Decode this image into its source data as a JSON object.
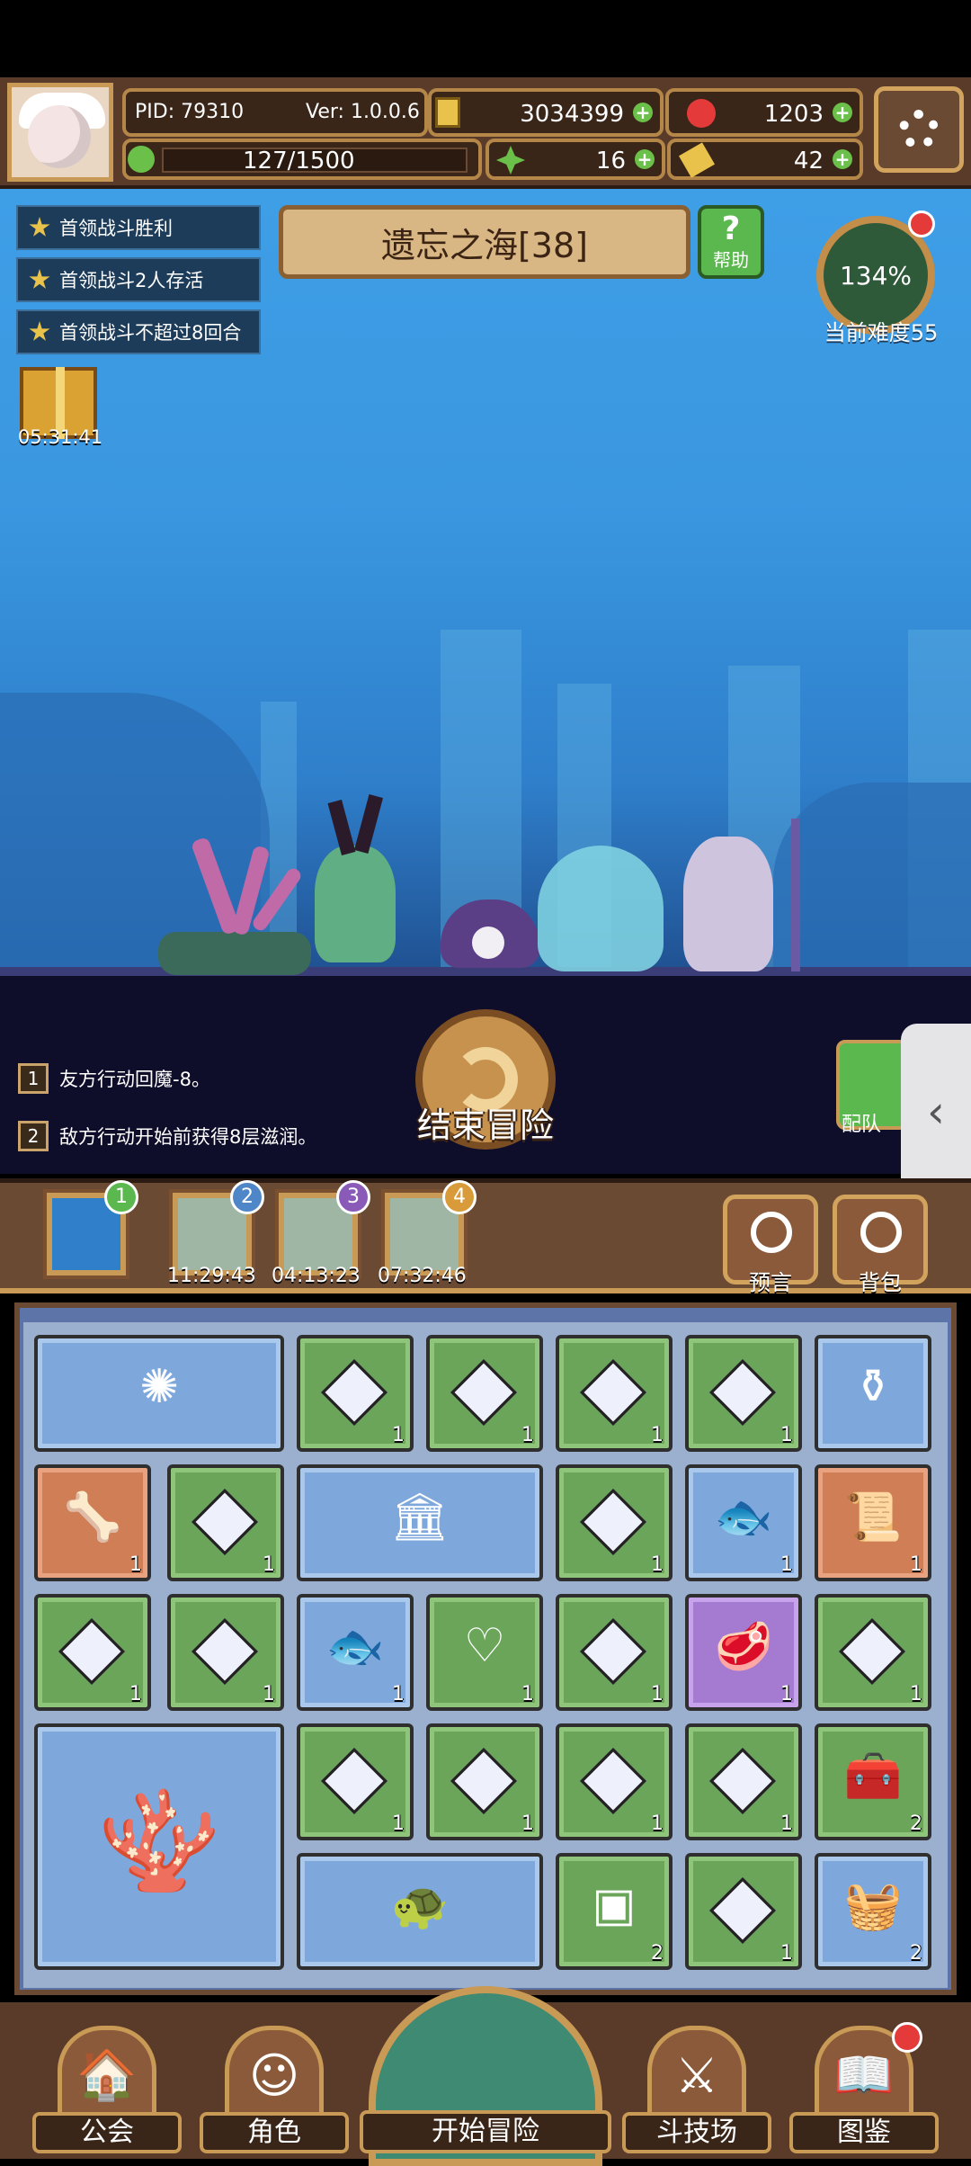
{
  "header": {
    "pid": "PID: 79310",
    "version": "Ver: 1.0.0.6",
    "gold": "3034399",
    "ruby": "1203",
    "stamina": "127/1500",
    "clover": "16",
    "hammer": "42"
  },
  "quests": [
    "首领战斗胜利",
    "首领战斗2人存活",
    "首领战斗不超过8回合"
  ],
  "stage": {
    "title": "遗忘之海[38]",
    "help_label": "帮助"
  },
  "difficulty": {
    "percent": "134%",
    "label": "当前难度55"
  },
  "gift": {
    "timer": "05:31:41"
  },
  "rules": [
    {
      "num": "1",
      "text": "友方行动回魔-8。"
    },
    {
      "num": "2",
      "text": "敌方行动开始前获得8层滋润。"
    }
  ],
  "end_button": "结束冒险",
  "team_button": "配队",
  "floors": [
    {
      "badge": "1",
      "time": ""
    },
    {
      "badge": "2",
      "time": "11:29:43"
    },
    {
      "badge": "3",
      "time": "04:13:23"
    },
    {
      "badge": "4",
      "time": "07:32:46"
    }
  ],
  "tabs": {
    "prophecy": "预言",
    "bag": "背包"
  },
  "inventory_counts": {
    "r1": [
      "1",
      "1",
      "1",
      "1"
    ],
    "r2": [
      "1",
      "1",
      "1",
      "1",
      "1"
    ],
    "r3": [
      "1",
      "1",
      "1",
      "1",
      "1",
      "1",
      "1"
    ],
    "r4": [
      "1",
      "1",
      "1",
      "1",
      "2"
    ],
    "r5": [
      "2",
      "1",
      "2"
    ]
  },
  "nav": {
    "guild": "公会",
    "character": "角色",
    "start": "开始冒险",
    "arena": "斗技场",
    "codex": "图鉴"
  },
  "colors": {
    "gem_cell": "#6aa55a",
    "sea_cell": "#7ea8dc",
    "accent_red": "#e53a3a"
  }
}
